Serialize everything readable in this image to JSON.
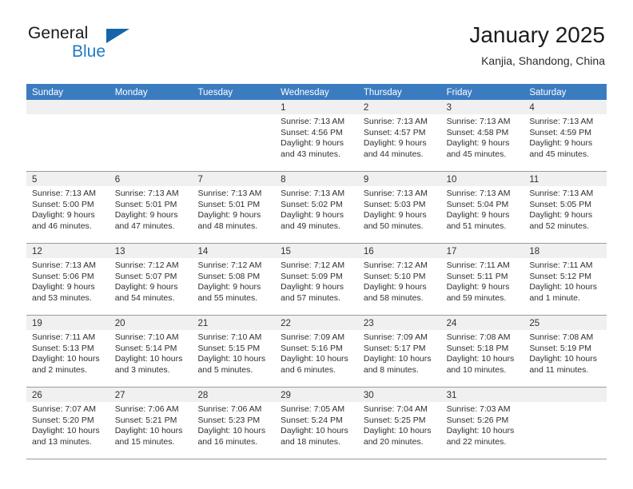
{
  "brand": {
    "name_part1": "General",
    "name_part2": "Blue",
    "accent_color": "#1f7ac4",
    "triangle_color": "#1565a8"
  },
  "header": {
    "title": "January 2025",
    "subtitle": "Kanjia, Shandong, China"
  },
  "theme": {
    "header_row_bg": "#3b7cc0",
    "header_row_text": "#ffffff",
    "date_band_bg": "#f0f0f0",
    "grid_line": "#9b9b9b",
    "body_text": "#2f2f2f"
  },
  "weekdays": [
    "Sunday",
    "Monday",
    "Tuesday",
    "Wednesday",
    "Thursday",
    "Friday",
    "Saturday"
  ],
  "weeks": [
    [
      {
        "empty": true
      },
      {
        "empty": true
      },
      {
        "empty": true
      },
      {
        "date": "1",
        "lines": [
          "Sunrise: 7:13 AM",
          "Sunset: 4:56 PM",
          "Daylight: 9 hours",
          "and 43 minutes."
        ]
      },
      {
        "date": "2",
        "lines": [
          "Sunrise: 7:13 AM",
          "Sunset: 4:57 PM",
          "Daylight: 9 hours",
          "and 44 minutes."
        ]
      },
      {
        "date": "3",
        "lines": [
          "Sunrise: 7:13 AM",
          "Sunset: 4:58 PM",
          "Daylight: 9 hours",
          "and 45 minutes."
        ]
      },
      {
        "date": "4",
        "lines": [
          "Sunrise: 7:13 AM",
          "Sunset: 4:59 PM",
          "Daylight: 9 hours",
          "and 45 minutes."
        ]
      }
    ],
    [
      {
        "date": "5",
        "lines": [
          "Sunrise: 7:13 AM",
          "Sunset: 5:00 PM",
          "Daylight: 9 hours",
          "and 46 minutes."
        ]
      },
      {
        "date": "6",
        "lines": [
          "Sunrise: 7:13 AM",
          "Sunset: 5:01 PM",
          "Daylight: 9 hours",
          "and 47 minutes."
        ]
      },
      {
        "date": "7",
        "lines": [
          "Sunrise: 7:13 AM",
          "Sunset: 5:01 PM",
          "Daylight: 9 hours",
          "and 48 minutes."
        ]
      },
      {
        "date": "8",
        "lines": [
          "Sunrise: 7:13 AM",
          "Sunset: 5:02 PM",
          "Daylight: 9 hours",
          "and 49 minutes."
        ]
      },
      {
        "date": "9",
        "lines": [
          "Sunrise: 7:13 AM",
          "Sunset: 5:03 PM",
          "Daylight: 9 hours",
          "and 50 minutes."
        ]
      },
      {
        "date": "10",
        "lines": [
          "Sunrise: 7:13 AM",
          "Sunset: 5:04 PM",
          "Daylight: 9 hours",
          "and 51 minutes."
        ]
      },
      {
        "date": "11",
        "lines": [
          "Sunrise: 7:13 AM",
          "Sunset: 5:05 PM",
          "Daylight: 9 hours",
          "and 52 minutes."
        ]
      }
    ],
    [
      {
        "date": "12",
        "lines": [
          "Sunrise: 7:13 AM",
          "Sunset: 5:06 PM",
          "Daylight: 9 hours",
          "and 53 minutes."
        ]
      },
      {
        "date": "13",
        "lines": [
          "Sunrise: 7:12 AM",
          "Sunset: 5:07 PM",
          "Daylight: 9 hours",
          "and 54 minutes."
        ]
      },
      {
        "date": "14",
        "lines": [
          "Sunrise: 7:12 AM",
          "Sunset: 5:08 PM",
          "Daylight: 9 hours",
          "and 55 minutes."
        ]
      },
      {
        "date": "15",
        "lines": [
          "Sunrise: 7:12 AM",
          "Sunset: 5:09 PM",
          "Daylight: 9 hours",
          "and 57 minutes."
        ]
      },
      {
        "date": "16",
        "lines": [
          "Sunrise: 7:12 AM",
          "Sunset: 5:10 PM",
          "Daylight: 9 hours",
          "and 58 minutes."
        ]
      },
      {
        "date": "17",
        "lines": [
          "Sunrise: 7:11 AM",
          "Sunset: 5:11 PM",
          "Daylight: 9 hours",
          "and 59 minutes."
        ]
      },
      {
        "date": "18",
        "lines": [
          "Sunrise: 7:11 AM",
          "Sunset: 5:12 PM",
          "Daylight: 10 hours",
          "and 1 minute."
        ]
      }
    ],
    [
      {
        "date": "19",
        "lines": [
          "Sunrise: 7:11 AM",
          "Sunset: 5:13 PM",
          "Daylight: 10 hours",
          "and 2 minutes."
        ]
      },
      {
        "date": "20",
        "lines": [
          "Sunrise: 7:10 AM",
          "Sunset: 5:14 PM",
          "Daylight: 10 hours",
          "and 3 minutes."
        ]
      },
      {
        "date": "21",
        "lines": [
          "Sunrise: 7:10 AM",
          "Sunset: 5:15 PM",
          "Daylight: 10 hours",
          "and 5 minutes."
        ]
      },
      {
        "date": "22",
        "lines": [
          "Sunrise: 7:09 AM",
          "Sunset: 5:16 PM",
          "Daylight: 10 hours",
          "and 6 minutes."
        ]
      },
      {
        "date": "23",
        "lines": [
          "Sunrise: 7:09 AM",
          "Sunset: 5:17 PM",
          "Daylight: 10 hours",
          "and 8 minutes."
        ]
      },
      {
        "date": "24",
        "lines": [
          "Sunrise: 7:08 AM",
          "Sunset: 5:18 PM",
          "Daylight: 10 hours",
          "and 10 minutes."
        ]
      },
      {
        "date": "25",
        "lines": [
          "Sunrise: 7:08 AM",
          "Sunset: 5:19 PM",
          "Daylight: 10 hours",
          "and 11 minutes."
        ]
      }
    ],
    [
      {
        "date": "26",
        "lines": [
          "Sunrise: 7:07 AM",
          "Sunset: 5:20 PM",
          "Daylight: 10 hours",
          "and 13 minutes."
        ]
      },
      {
        "date": "27",
        "lines": [
          "Sunrise: 7:06 AM",
          "Sunset: 5:21 PM",
          "Daylight: 10 hours",
          "and 15 minutes."
        ]
      },
      {
        "date": "28",
        "lines": [
          "Sunrise: 7:06 AM",
          "Sunset: 5:23 PM",
          "Daylight: 10 hours",
          "and 16 minutes."
        ]
      },
      {
        "date": "29",
        "lines": [
          "Sunrise: 7:05 AM",
          "Sunset: 5:24 PM",
          "Daylight: 10 hours",
          "and 18 minutes."
        ]
      },
      {
        "date": "30",
        "lines": [
          "Sunrise: 7:04 AM",
          "Sunset: 5:25 PM",
          "Daylight: 10 hours",
          "and 20 minutes."
        ]
      },
      {
        "date": "31",
        "lines": [
          "Sunrise: 7:03 AM",
          "Sunset: 5:26 PM",
          "Daylight: 10 hours",
          "and 22 minutes."
        ]
      },
      {
        "empty": true
      }
    ]
  ]
}
